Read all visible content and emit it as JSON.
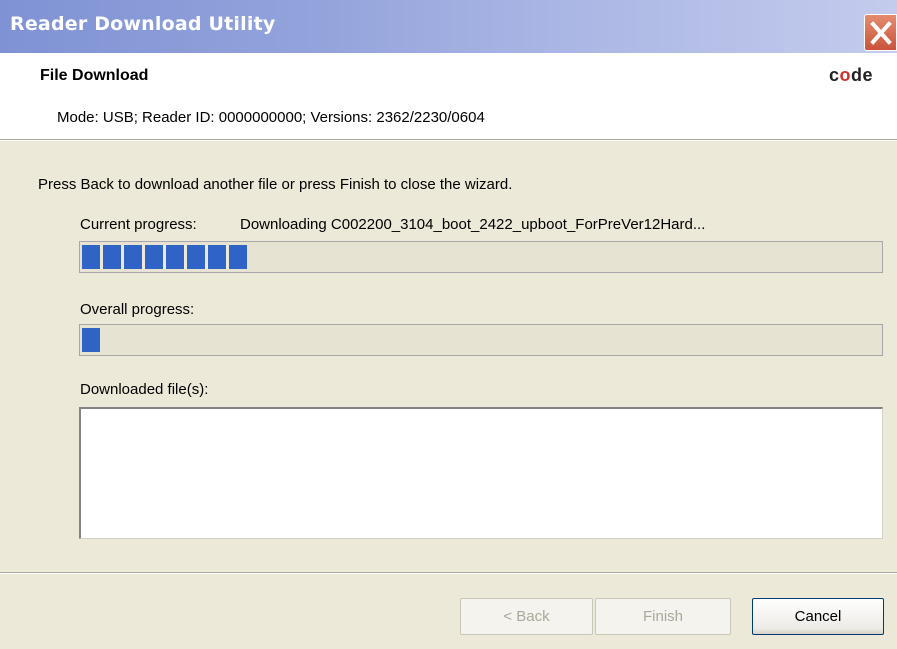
{
  "window": {
    "title": "Reader Download Utility",
    "close_icon": "close-icon"
  },
  "header": {
    "title": "File Download",
    "logo": "code",
    "subtitle": "Mode: USB; Reader ID: 0000000000; Versions: 2362/2230/0604"
  },
  "main": {
    "instruction": "Press Back to download another file or press Finish to close the wizard.",
    "current_progress_label": "Current progress:",
    "current_file": "Downloading C002200_3104_boot_2422_upboot_ForPreVer12Hard...",
    "current_progress_value": 0.2,
    "overall_progress_label": "Overall progress:",
    "overall_progress_value": 0.02,
    "downloaded_files_label": "Downloaded file(s):",
    "downloaded_files": []
  },
  "buttons": {
    "back_label": "< Back",
    "finish_label": "Finish",
    "cancel_label": "Cancel"
  },
  "colors": {
    "title_bar": "#7F92D4",
    "progress_fill": "#2F64C6",
    "close_button": "#C9543A",
    "logo_accent": "#D0312D"
  }
}
